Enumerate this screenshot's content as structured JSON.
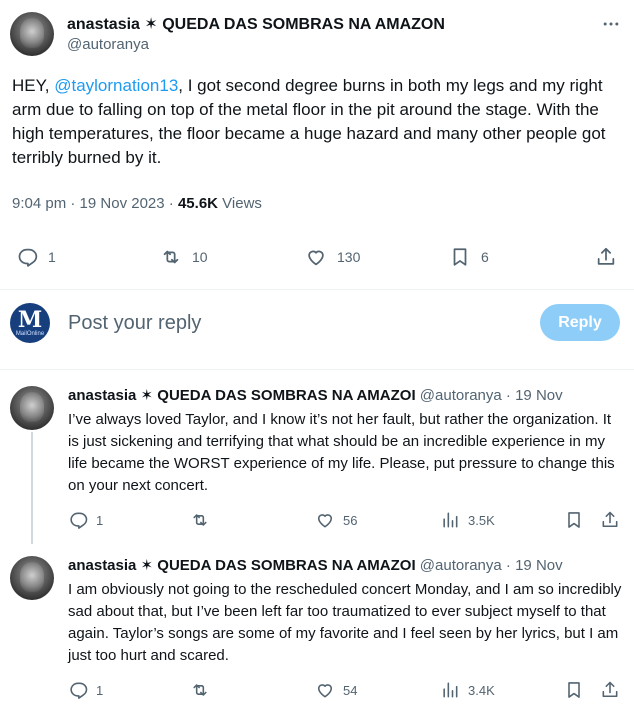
{
  "main_tweet": {
    "author_name": "anastasia ✶ QUEDA DAS SOMBRAS NA AMAZON",
    "author_handle": "@autoranya",
    "text_before": "HEY, ",
    "mention": "@taylornation13",
    "text_after": ", I got second degree burns in both my legs and my right arm due to falling on top of the metal floor in the pit around the stage. With the high temperatures, the floor became a huge hazard and many other people got terribly burned by it.",
    "time": "9:04 pm",
    "date": "19 Nov 2023",
    "views_count": "45.6K",
    "views_label": "Views",
    "replies": "1",
    "reposts": "10",
    "likes": "130",
    "bookmarks": "6"
  },
  "reply_composer": {
    "placeholder": "Post your reply",
    "button_label": "Reply",
    "logo_letter": "M",
    "logo_word": "MailOnline"
  },
  "replies": [
    {
      "author_name": "anastasia ✶ QUEDA DAS SOMBRAS NA AMAZOI",
      "author_handle": "@autoranya",
      "separator": " · ",
      "date": "19 Nov",
      "text": "I’ve always loved Taylor, and I know it’s not her fault, but rather the organization. It is just sickening and terrifying that what should be an incredible experience in my life became the WORST experience of my life. Please, put pressure to change this on your next concert.",
      "replies": "1",
      "reposts": "",
      "likes": "56",
      "views": "3.5K"
    },
    {
      "author_name": "anastasia ✶ QUEDA DAS SOMBRAS NA AMAZOI",
      "author_handle": "@autoranya",
      "separator": " · ",
      "date": "19 Nov",
      "text": "I am obviously not going to the rescheduled concert Monday, and I am so incredibly sad about that, but I’ve been left far too traumatized to ever subject myself to that again. Taylor’s songs are some of my favorite and I feel seen by her lyrics, but I am just too hurt and scared.",
      "replies": "1",
      "reposts": "",
      "likes": "54",
      "views": "3.4K"
    }
  ],
  "icons": {
    "more": "more-icon",
    "reply": "reply-icon",
    "repost": "repost-icon",
    "like": "heart-icon",
    "bookmark": "bookmark-icon",
    "share": "share-icon",
    "views": "views-icon"
  },
  "colors": {
    "accent": "#1d9bf0",
    "reply_button": "#8ecdf8",
    "secondary_text": "#536471",
    "logo_bg": "#173f7e"
  }
}
